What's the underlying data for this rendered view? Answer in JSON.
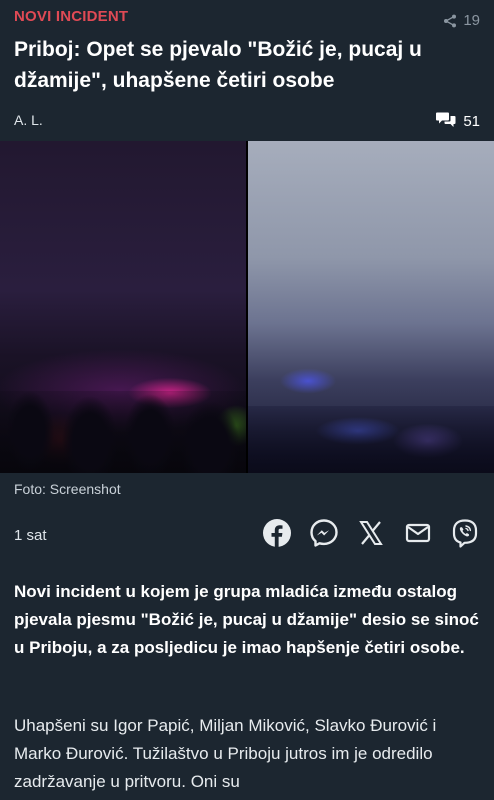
{
  "article": {
    "category": "NOVI INCIDENT",
    "share_count": "19",
    "headline": "Priboj: Opet se pjevalo \"Božić je, pucaj u džamije\", uhapšene četiri osobe",
    "author": "A. L.",
    "comment_count": "51",
    "photo_caption": "Foto: Screenshot",
    "published": "1 sat",
    "lead": "Novi incident u kojem je grupa mladića između ostalog pjevala pjesmu \"Božić je, pucaj u džamije\" desio se sinoć u Priboju, a za posljedicu je imao hapšenje četiri osobe.",
    "body": "Uhapšeni su Igor Papić, Miljan Miković, Slavko Đurović i Marko Đurović. Tužilaštvo u Priboju jutros im je odredilo zadržavanje u pritvoru. Oni su"
  },
  "share_icons": [
    "facebook-icon",
    "messenger-icon",
    "x-icon",
    "mail-icon",
    "viber-icon"
  ],
  "colors": {
    "background": "#1c2630",
    "category": "#e04a55",
    "muted": "#8b96a1",
    "text": "#ffffff"
  }
}
